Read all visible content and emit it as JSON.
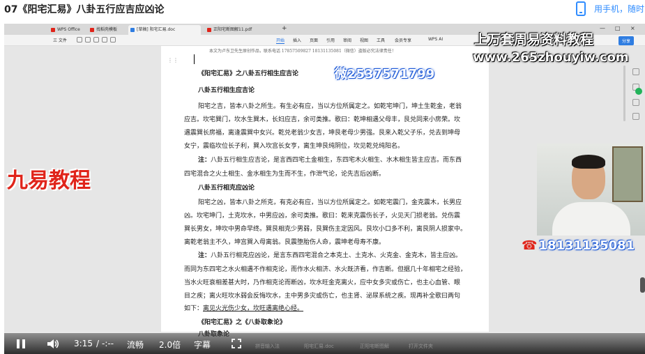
{
  "header": {
    "video_title": "07《阳宅汇易》八卦五行应吉应凶论",
    "phone_link": "用手机，随时"
  },
  "wps": {
    "tabs": [
      {
        "label": "WPS Office",
        "color": "#e0241a"
      },
      {
        "label": "找稻壳模板",
        "color": "#e0241a"
      },
      {
        "label": "[草稿] 阳宅汇易.doc",
        "color": "#2f7de1"
      },
      {
        "label": "正阳宅断图解11.pdf",
        "color": "#e0241a"
      }
    ],
    "tab_add": "+",
    "window_controls": [
      "—",
      "□",
      "×"
    ],
    "file_menu": "三 文件",
    "menus": [
      "开始",
      "插入",
      "页面",
      "引用",
      "审阅",
      "视图",
      "工具",
      "会员专享"
    ],
    "ai_label": "WPS AI",
    "share_label": "分享"
  },
  "document": {
    "header_line": "本文为卢东卫先生原创作品，联系电话 17857509827   18131135081（微信）盗版必究法律责任！",
    "lines": [
      {
        "text": "《阳宅汇易》之八卦五行相生应吉论",
        "bold": true
      },
      {
        "text": "八卦五行相生应吉论",
        "bold": true
      },
      {
        "text": "阳宅之吉，皆本八卦之所生。有生必有应，当以方位所属定之。如乾宅坤门，坤土生乾金，老翁"
      },
      {
        "text": "应吉。坎宅巽门，坎水生巽木，长妇应吉，余可类推。歌曰：乾坤相遇父母丰，艮兑同来小房荣。坎"
      },
      {
        "text": "遇震巽长房福，离逢震巽中女兴。乾兑老翁少女吉，坤艮老母少男强。艮来入乾父子乐，兑去到坤母"
      },
      {
        "text": "女宁，震临坎位长子利，巽入坎宫长女亨，离生坤艮纯阴位，坎见乾兑纯阳名。"
      },
      {
        "text": "注：八卦五行相生应吉论，是言西四宅土金相生，东四宅木火相生、水木相生皆主应吉。而东西",
        "bold_prefix": "注："
      },
      {
        "text": "四宅混合之火土相生、金水相生为生而不生，作泄气论，论先吉后凶断。"
      },
      {
        "text": "八卦五行相克应凶论",
        "bold": true
      },
      {
        "text": "阳宅之凶，皆本八卦之所克，有克必有应，当以方位所属定之。如乾宅震门，金克震木，长男应"
      },
      {
        "text": "凶。坎宅坤门，土克坎水，中男应凶，余可类推。歌曰：乾来克震伤长子，火见天门损老翁。兑伤震"
      },
      {
        "text": "巽长男女，坤坎中男命早终。巽艮相克少男弱，艮巽伤主定因风。艮坎小口多不利，离艮阴人损家中。"
      },
      {
        "text": "离乾老翁主不久，坤宫巽入母离翁。艮震堕胎伤人命，震坤老母寿不康。"
      },
      {
        "text": "注：八卦五行相克应凶论，是言东西四宅混合之本克土、土克水、火克金、金克木，皆主应凶。",
        "bold_prefix": "注："
      },
      {
        "text": "而同为东四宅之水火相遇不作相克论，而作水火相济、水火既济看，作吉断。但据几十年相宅之经验，"
      },
      {
        "text": "当水火旺衰相差甚大时，乃作相克论而断凶，坎水旺金克离火，应中女多灾或伤亡，也主心血管、眼"
      },
      {
        "text": "目之疾；离火旺坎水弱会反悔坎水，主中男多灾或伤亡，也主肾、泌尿系统之疾。现再补全歌曰两句"
      },
      {
        "text": "如下：离见火光伤少女，坎旺遇离绝心经。",
        "underline_from": 3
      },
      {
        "text": "《阳宅汇易》之《八卦取象论》",
        "bold": true
      },
      {
        "text": "八卦取象论",
        "bold": true
      }
    ]
  },
  "overlays": {
    "title": "上万套周易资料教程",
    "url": "www.265zhouyiw.com",
    "wechat": "微2537571799",
    "brand": "九易教程",
    "phone": "18131135081",
    "tel_icon": "☎"
  },
  "player": {
    "current_time": "3:15",
    "separator": "/",
    "duration": "-:--",
    "quality": "流畅",
    "speed": "2.0倍",
    "subtitle": "字幕",
    "taskbar_ghost": [
      "拼音输入法",
      "阳宅汇易.doc",
      "正阳宅断图解",
      "打开文件夹"
    ]
  }
}
